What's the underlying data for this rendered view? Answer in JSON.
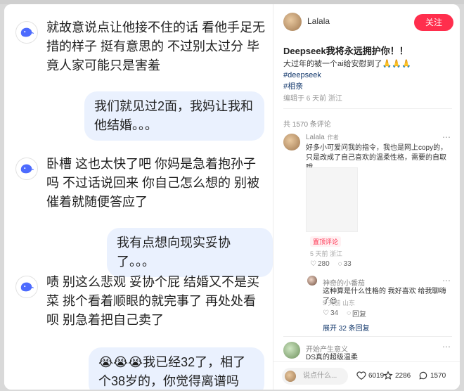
{
  "chat": {
    "messages": [
      {
        "role": "ai",
        "text": "就故意说点让他接不住的话 看他手足无措的样子 挺有意思的 不过别太过分 毕竟人家可能只是害羞"
      },
      {
        "role": "user",
        "text": "我们就见过2面，我妈让我和他结婚。。。"
      },
      {
        "role": "ai",
        "text": "卧槽 这也太快了吧 你妈是急着抱孙子吗 不过话说回来 你自己怎么想的 别被催着就随便答应了"
      },
      {
        "role": "user",
        "text": "我有点想向现实妥协了。。。"
      },
      {
        "role": "ai",
        "text": "啧 别这么悲观 妥协个屁 结婚又不是买菜 挑个看着顺眼的就完事了 再处处看呗 别急着把自己卖了"
      },
      {
        "role": "user",
        "text": "😭😭😭我已经32了，相了个38岁的，你觉得离谱吗"
      }
    ]
  },
  "post": {
    "author": "Lalala",
    "follow_label": "关注",
    "title": "Deepseek我将永远拥护你！！",
    "body": "大过年的被一个ai给安慰到了🙏🙏🙏",
    "tags": [
      "#deepseek",
      "#相亲"
    ],
    "meta": "编辑于 6 天前 浙江",
    "comment_count": "共 1570 条评论"
  },
  "comments": [
    {
      "name": "Lalala",
      "author_tag": "作者",
      "text": "好多小可爱问我的指令，我也是网上copy的，只是改成了自己喜欢的温柔性格，需要的自取哦",
      "pill": "置顶评论",
      "meta": "5 天前 浙江",
      "likes": "280",
      "replies": "33"
    },
    {
      "name": "神奇的小番茄",
      "text": "这种算是什么性格的 我好喜欢 给我聊嗨了😍",
      "meta": "5 天前 山东",
      "likes": "34",
      "reply_label": "回复"
    },
    {
      "expand": "展开 32 条回复"
    },
    {
      "name": "开始产生意义",
      "text": "DS真的超级温柔"
    }
  ],
  "bottom_bar": {
    "input_placeholder": "说点什么...",
    "likes": "6019",
    "stars": "2286",
    "comments": "1570"
  }
}
